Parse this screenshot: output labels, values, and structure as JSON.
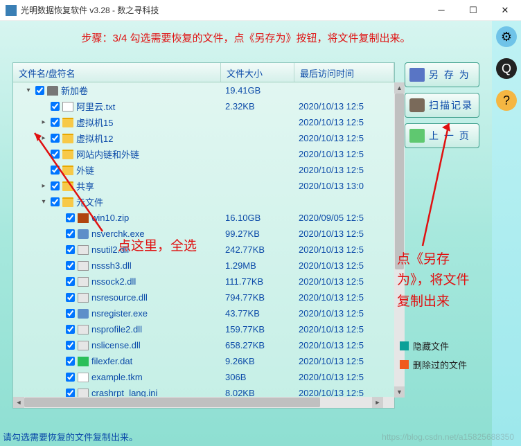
{
  "window": {
    "title": "光明数据恢复软件 v3.28 - 数之寻科技"
  },
  "banner": "步骤：3/4 勾选需要恢复的文件，点《另存为》按钮，将文件复制出来。",
  "columns": {
    "name": "文件名/盘符名",
    "size": "文件大小",
    "date": "最后访问时间"
  },
  "rows": [
    {
      "indent": 0,
      "exp": "▾",
      "icon": "disk",
      "name": "新加卷",
      "size": "19.41GB",
      "date": ""
    },
    {
      "indent": 1,
      "exp": "",
      "icon": "txt",
      "name": "阿里云.txt",
      "size": "2.32KB",
      "date": "2020/10/13 12:5"
    },
    {
      "indent": 1,
      "exp": "▸",
      "icon": "folder",
      "name": "虚拟机15",
      "size": "",
      "date": "2020/10/13 12:5"
    },
    {
      "indent": 1,
      "exp": "▸",
      "icon": "folder",
      "name": "虚拟机12",
      "size": "",
      "date": "2020/10/13 12:5"
    },
    {
      "indent": 1,
      "exp": "",
      "icon": "folder",
      "name": "网站内链和外链",
      "size": "",
      "date": "2020/10/13 12:5"
    },
    {
      "indent": 1,
      "exp": "",
      "icon": "folder",
      "name": "外链",
      "size": "",
      "date": "2020/10/13 12:5"
    },
    {
      "indent": 1,
      "exp": "▸",
      "icon": "folder",
      "name": "共享",
      "size": "",
      "date": "2020/10/13 13:0"
    },
    {
      "indent": 1,
      "exp": "▾",
      "icon": "folder",
      "name": "元文件",
      "size": "",
      "date": ""
    },
    {
      "indent": 2,
      "exp": "",
      "icon": "zip",
      "name": "win10.zip",
      "size": "16.10GB",
      "date": "2020/09/05 12:5"
    },
    {
      "indent": 2,
      "exp": "",
      "icon": "exe",
      "name": "nsverchk.exe",
      "size": "99.27KB",
      "date": "2020/10/13 12:5"
    },
    {
      "indent": 2,
      "exp": "",
      "icon": "dll",
      "name": "nsutil2.dll",
      "size": "242.77KB",
      "date": "2020/10/13 12:5"
    },
    {
      "indent": 2,
      "exp": "",
      "icon": "dll",
      "name": "nsssh3.dll",
      "size": "1.29MB",
      "date": "2020/10/13 12:5"
    },
    {
      "indent": 2,
      "exp": "",
      "icon": "dll",
      "name": "nssock2.dll",
      "size": "111.77KB",
      "date": "2020/10/13 12:5"
    },
    {
      "indent": 2,
      "exp": "",
      "icon": "dll",
      "name": "nsresource.dll",
      "size": "794.77KB",
      "date": "2020/10/13 12:5"
    },
    {
      "indent": 2,
      "exp": "",
      "icon": "exe",
      "name": "nsregister.exe",
      "size": "43.77KB",
      "date": "2020/10/13 12:5"
    },
    {
      "indent": 2,
      "exp": "",
      "icon": "dll",
      "name": "nsprofile2.dll",
      "size": "159.77KB",
      "date": "2020/10/13 12:5"
    },
    {
      "indent": 2,
      "exp": "",
      "icon": "dll",
      "name": "nslicense.dll",
      "size": "658.27KB",
      "date": "2020/10/13 12:5"
    },
    {
      "indent": 2,
      "exp": "",
      "icon": "dat",
      "name": "filexfer.dat",
      "size": "9.26KB",
      "date": "2020/10/13 12:5"
    },
    {
      "indent": 2,
      "exp": "",
      "icon": "blank",
      "name": "example.tkm",
      "size": "306B",
      "date": "2020/10/13 12:5"
    },
    {
      "indent": 2,
      "exp": "",
      "icon": "ini",
      "name": "crashrpt_lang.ini",
      "size": "8.02KB",
      "date": "2020/10/13 12:5"
    }
  ],
  "buttons": {
    "save_as": "另 存 为",
    "scan_log": "扫描记录",
    "prev_page": "上 一 页"
  },
  "annot": {
    "select_all": "点这里，全选",
    "save_hint": "点《另存为》，将文件复制出来"
  },
  "legend": {
    "hidden": "隐藏文件",
    "deleted": "删除过的文件"
  },
  "status": "请勾选需要恢复的文件复制出来。",
  "watermark": "https://blog.csdn.net/a15825688350",
  "colors": {
    "hidden": "#0aa098",
    "deleted": "#f05a1c"
  }
}
